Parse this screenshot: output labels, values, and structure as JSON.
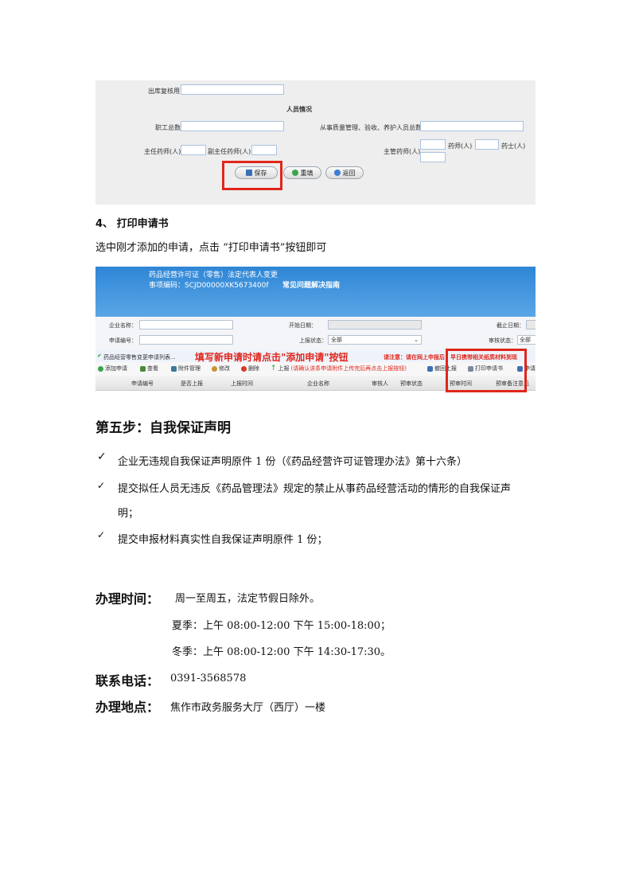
{
  "form_shot": {
    "outbound_label": "出库复核用",
    "personnel_title": "人员情况",
    "staff_total_label": "职工总数",
    "qc_total_label": "从事质量管理、验收、养护人员总数",
    "chief_pharm_label": "主任药师(人)",
    "deputy_chief_pharm_label": "副主任药师(人)",
    "supervising_pharm_label": "主管药师(人)",
    "pharmacist_label": "药师(人)",
    "pharm_assistant_label": "药士(人)",
    "save_label": "保存",
    "refill_label": "重填",
    "back_label": "返回"
  },
  "step4": {
    "heading": "4、  打印申请书",
    "instruction": "选中刚才添加的申请，点击 “打印申请书”按钮即可"
  },
  "list_shot": {
    "header_line1": "药品经营许可证（零售）法定代表人变更",
    "header_line2": "事项编码：SCJD00000XK5673400f",
    "faq_link": "常见问题解决指南",
    "company_label": "企业名称：",
    "start_date_label": "开始日期：",
    "end_date_label": "截止日期：",
    "apply_no_label": "申请编号：",
    "report_status_label": "上报状态：",
    "report_status_value": "全部",
    "review_status_label": "审核状态：",
    "review_status_value": "全部",
    "list_title": "药品经营零售变更申请列表...",
    "red_hint": "填写新申请时请点击\"添加申请\"按钮",
    "notice": "请注意：请在网上申报后，早日携带相关纸质材料到现",
    "toolbar": {
      "add": "添加申请",
      "view": "查看",
      "attach": "附件管理",
      "edit": "修改",
      "delete": "删除",
      "report": "上报",
      "report_hint": "(请确认该条申请附件上传完后再点击上报按钮)",
      "withdraw": "撤回上报",
      "print": "打印申请书",
      "more": "申请"
    },
    "columns": [
      "申请编号",
      "是否上报",
      "上报时间",
      "企业名称",
      "审核人",
      "预审状态",
      "预审时间",
      "预审备注意见"
    ]
  },
  "step5": {
    "heading": "第五步：自我保证声明",
    "check_mark": "✓",
    "items": [
      "企业无违规自我保证声明原件 1 份（《药品经营许可证管理办法》第十六条）",
      "提交拟任人员无违反《药品管理法》规定的禁止从事药品经营活动的情形的自我保证声",
      "明；",
      "提交申报材料真实性自我保证声明原件 1 份；"
    ]
  },
  "office_hours": {
    "label": "办理时间：",
    "weekdays": "周一至周五，法定节假日除外。",
    "summer": "夏季：上午 08:00-12:00 下午  15:00-18:00；",
    "winter": "冬季：上午 08:00-12:00  下午 14:30-17:30。"
  },
  "contact": {
    "phone_label": "联系电话：",
    "phone": "0391-3568578",
    "address_label": "办理地点：",
    "address": "焦作市政务服务大厅（西厅）一楼"
  },
  "colors": {
    "highlight_red": "#e0261c",
    "header_blue": "#2f86d6",
    "panel_gray": "#eeeeee"
  }
}
